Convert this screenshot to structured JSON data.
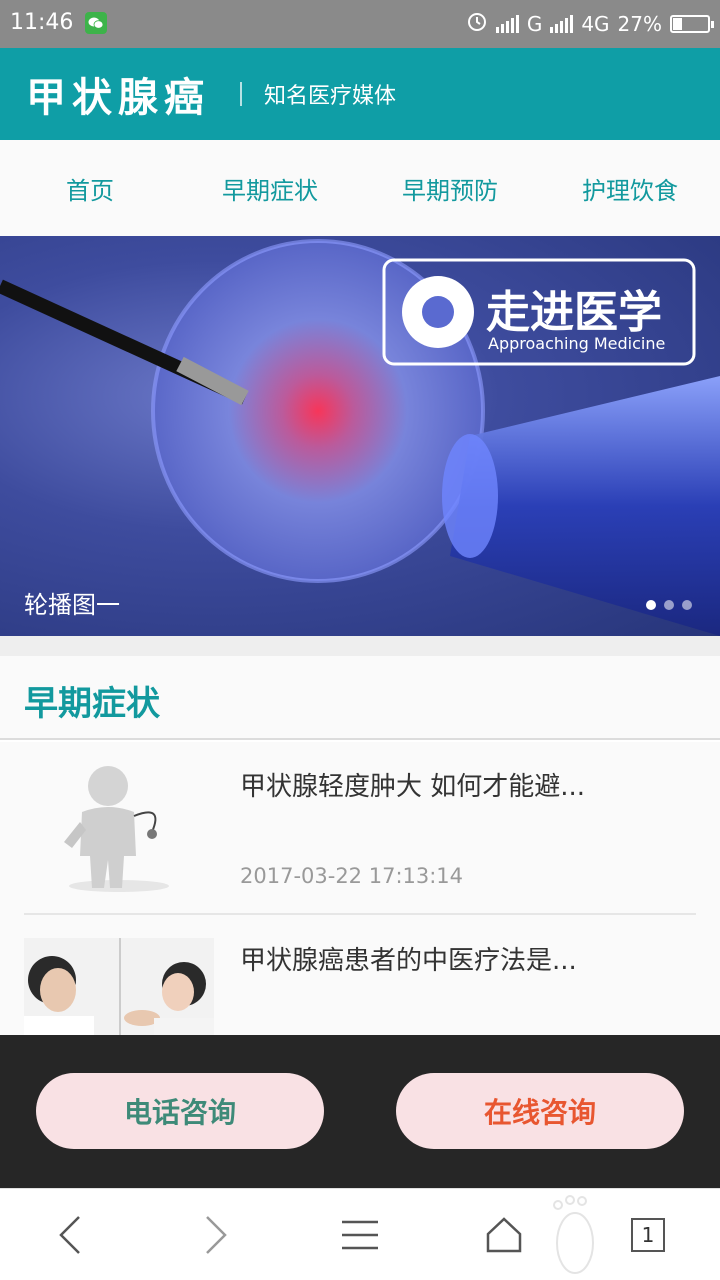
{
  "status_bar": {
    "time": "11:46",
    "network1": "G",
    "network2": "4G",
    "battery_text": "27%",
    "battery_level": 0.27
  },
  "header": {
    "brand": "甲状腺癌",
    "tagline": "知名医疗媒体"
  },
  "nav": {
    "items": [
      {
        "label": "首页"
      },
      {
        "label": "早期症状"
      },
      {
        "label": "早期预防"
      },
      {
        "label": "护理饮食"
      }
    ]
  },
  "banner": {
    "caption": "轮播图一",
    "logo_text": "走进医学",
    "logo_subtext": "Approaching Medicine",
    "slide_count": 3,
    "active_slide": 1
  },
  "section": {
    "title": "早期症状"
  },
  "articles": [
    {
      "title": "甲状腺轻度肿大 如何才能避...",
      "date": "2017-03-22 17:13:14"
    },
    {
      "title": "甲状腺癌患者的中医疗法是...",
      "date": ""
    }
  ],
  "consult": {
    "phone_label": "电话咨询",
    "online_label": "在线咨询"
  },
  "browser": {
    "tab_count": "1"
  },
  "colors": {
    "brand_teal": "#0f9ea6",
    "nav_text": "#12999e",
    "online_orange": "#e85630",
    "phone_green": "#3e8a78"
  }
}
